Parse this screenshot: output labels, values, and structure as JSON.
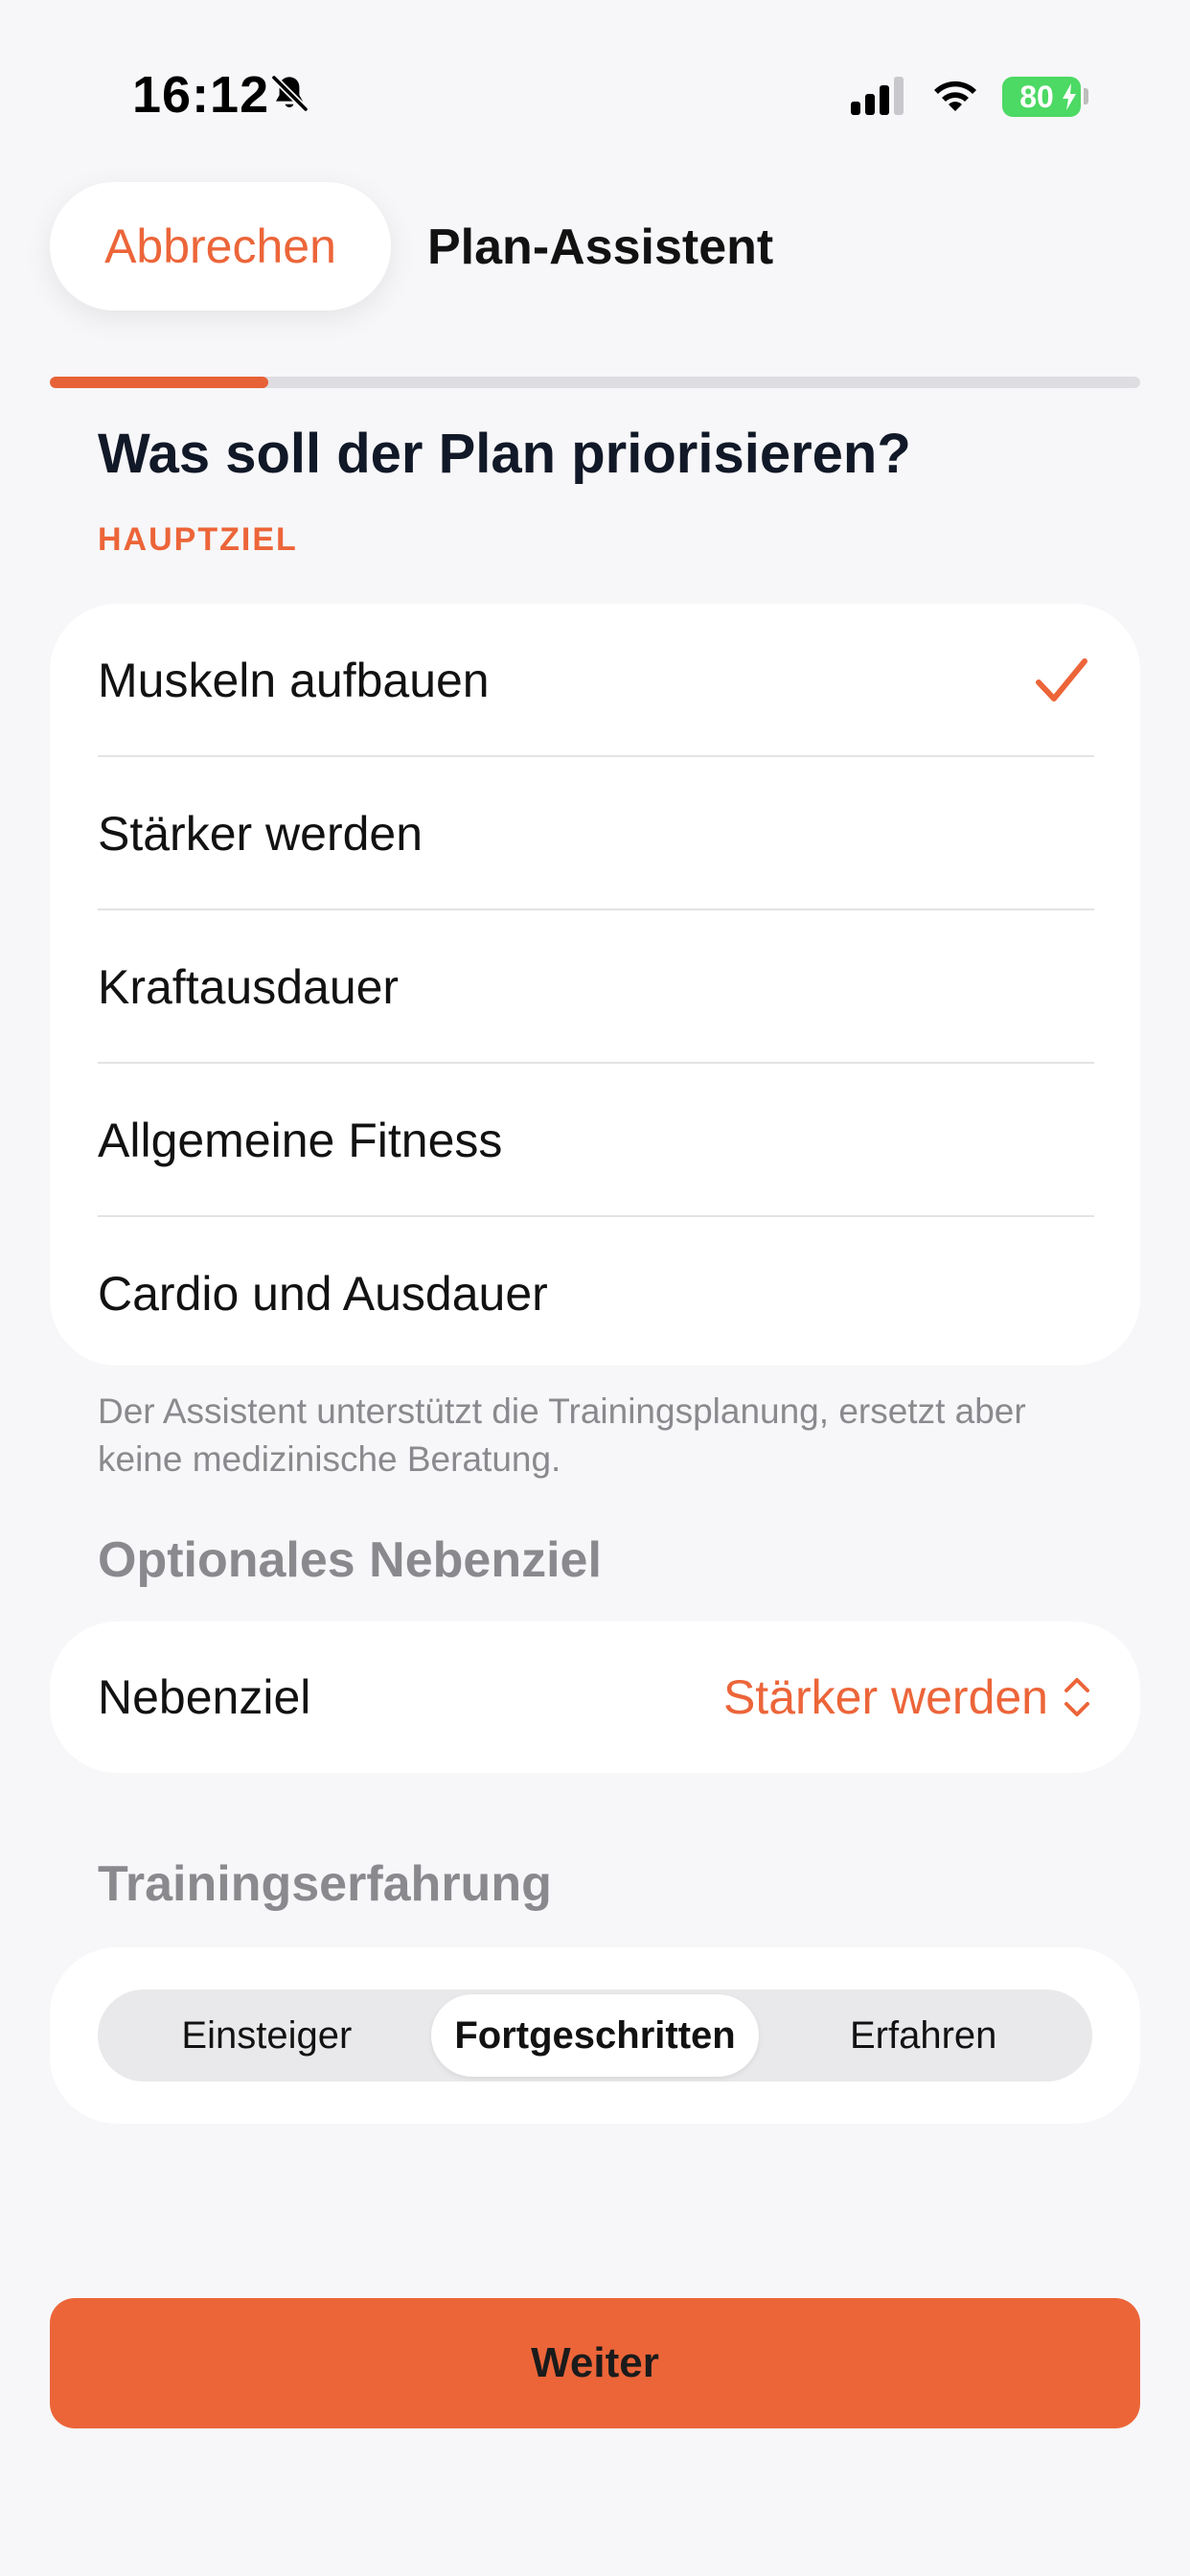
{
  "status_bar": {
    "time": "16:12",
    "battery": "80",
    "icons": [
      "bell-slash-icon",
      "cellular-signal-icon",
      "wifi-icon",
      "battery-icon",
      "charging-bolt-icon"
    ]
  },
  "header": {
    "cancel_label": "Abbrechen",
    "title": "Plan-Assistent"
  },
  "progress": {
    "fraction": 0.2
  },
  "question": "Was soll der Plan priorisieren?",
  "main_goal": {
    "section_label": "HAUPTZIEL",
    "options": [
      {
        "label": "Muskeln aufbauen",
        "selected": true
      },
      {
        "label": "Stärker werden",
        "selected": false
      },
      {
        "label": "Kraftausdauer",
        "selected": false
      },
      {
        "label": "Allgemeine Fitness",
        "selected": false
      },
      {
        "label": "Cardio und Ausdauer",
        "selected": false
      }
    ]
  },
  "disclaimer": "Der Assistent unterstützt die Trainingsplanung, ersetzt aber keine medizinische Beratung.",
  "secondary_goal": {
    "heading": "Optionales Nebenziel",
    "label": "Nebenziel",
    "value": "Stärker werden"
  },
  "experience": {
    "heading": "Trainingserfahrung",
    "options": [
      "Einsteiger",
      "Fortgeschritten",
      "Erfahren"
    ],
    "selected_index": 1
  },
  "continue_label": "Weiter",
  "colors": {
    "accent": "#ec6539",
    "background": "#f7f7f9",
    "card": "#ffffff",
    "muted_text": "#8a8a8e",
    "battery_green": "#4cd964"
  }
}
